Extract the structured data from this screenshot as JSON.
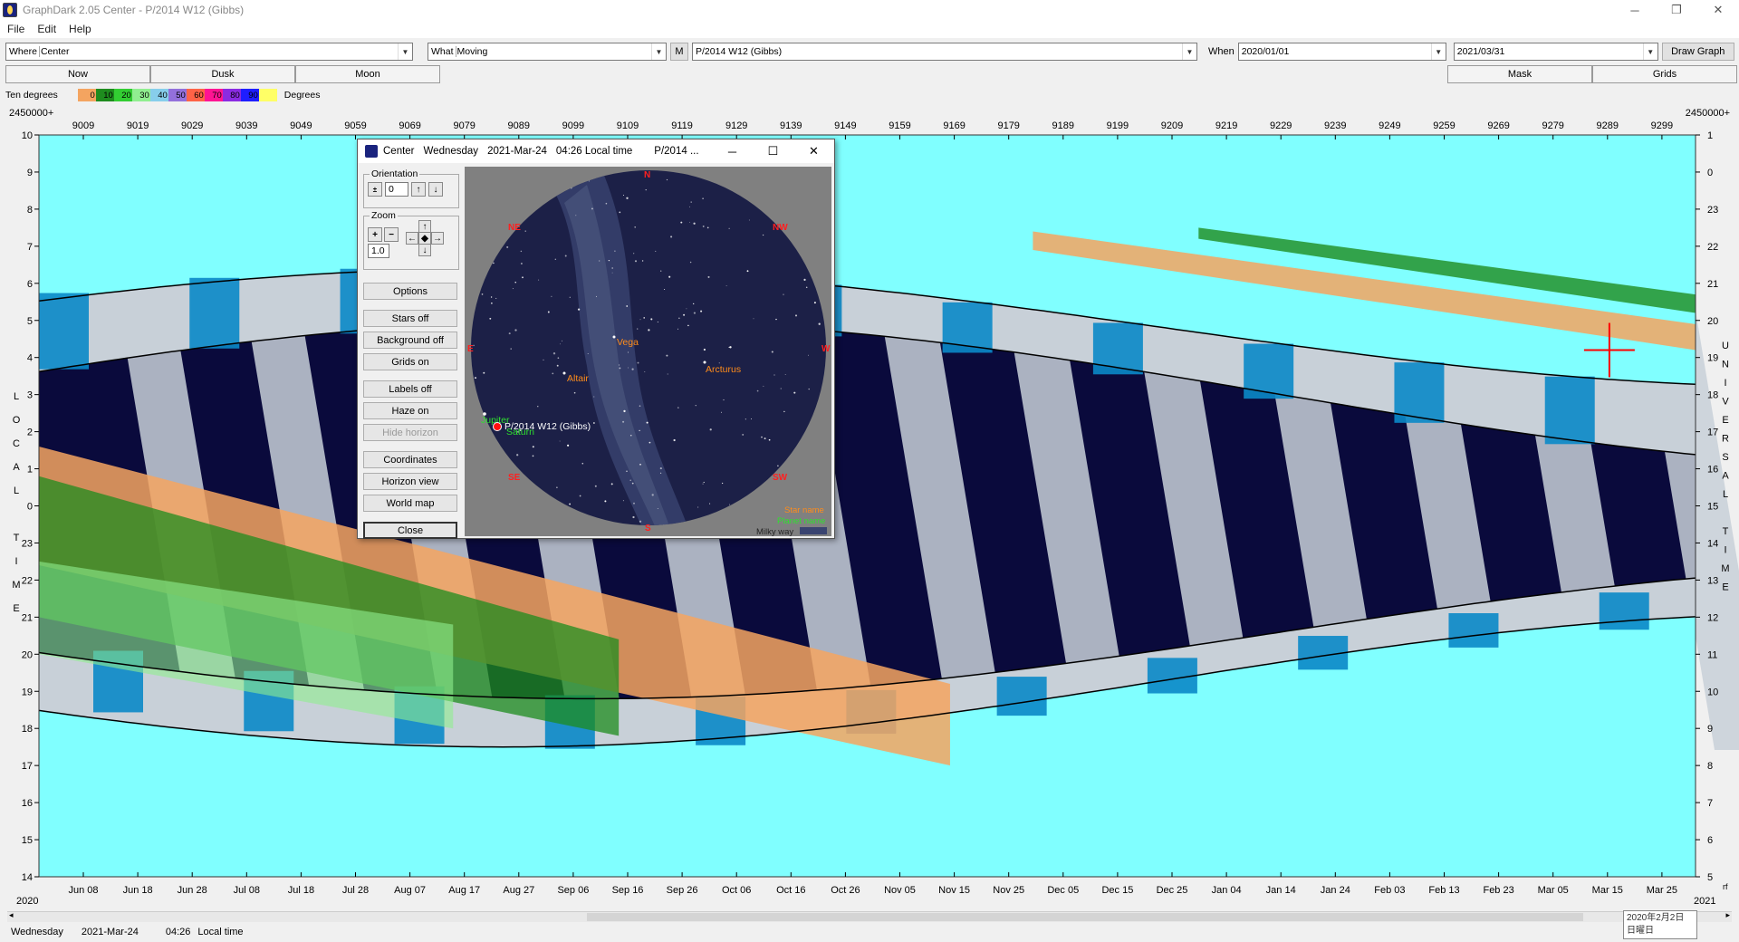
{
  "window": {
    "title": "GraphDark 2.05  Center  -  P/2014 W12 (Gibbs)",
    "minimize": "─",
    "maximize": "❐",
    "close": "✕"
  },
  "menu": [
    "File",
    "Edit",
    "Help"
  ],
  "toolbar": {
    "where_label": "Where",
    "where_value": "Center",
    "what_label": "What",
    "what_value": "Moving",
    "m_button": "M",
    "object_value": "P/2014 W12 (Gibbs)",
    "when_label": "When",
    "when_start": "2020/01/01",
    "when_end": "2021/03/31",
    "draw_graph": "Draw Graph"
  },
  "tabs_left": [
    "Now",
    "Dusk",
    "Moon"
  ],
  "tabs_right": [
    "Mask",
    "Grids"
  ],
  "legend": {
    "label": "Ten degrees",
    "segments": [
      {
        "text": "0",
        "color": "#f4a460"
      },
      {
        "text": "10",
        "color": "#1e8c1e"
      },
      {
        "text": "20",
        "color": "#32cd32"
      },
      {
        "text": "30",
        "color": "#90ee90"
      },
      {
        "text": "40",
        "color": "#87ceeb"
      },
      {
        "text": "50",
        "color": "#9370db"
      },
      {
        "text": "60",
        "color": "#ff6347"
      },
      {
        "text": "70",
        "color": "#ff1493"
      },
      {
        "text": "80",
        "color": "#8a2be2"
      },
      {
        "text": "90",
        "color": "#1e1eff"
      },
      {
        "text": "",
        "color": "#ffff66"
      }
    ],
    "unit": "Degrees"
  },
  "chart": {
    "jd_prefix_left": "2450000+",
    "jd_prefix_right": "2450000+",
    "jd_ticks": [
      "9009",
      "9019",
      "9029",
      "9039",
      "9049",
      "9059",
      "9069",
      "9079",
      "9089",
      "9099",
      "9109",
      "9119",
      "9129",
      "9139",
      "9149",
      "9159",
      "9169",
      "9179",
      "9189",
      "9199",
      "9209",
      "9219",
      "9229",
      "9239",
      "9249",
      "9259",
      "9269",
      "9279",
      "9289",
      "9299"
    ],
    "date_ticks": [
      "Jun 08",
      "Jun 18",
      "Jun 28",
      "Jul 08",
      "Jul 18",
      "Jul 28",
      "Aug 07",
      "Aug 17",
      "Aug 27",
      "Sep 06",
      "Sep 16",
      "Sep 26",
      "Oct 06",
      "Oct 16",
      "Oct 26",
      "Nov 05",
      "Nov 15",
      "Nov 25",
      "Dec 05",
      "Dec 15",
      "Dec 25",
      "Jan 04",
      "Jan 14",
      "Jan 24",
      "Feb 03",
      "Feb 13",
      "Feb 23",
      "Mar 05",
      "Mar 15",
      "Mar 25"
    ],
    "year_left": "2020",
    "year_right": "2021",
    "year_right_suffix": "rf",
    "left_axis_title": [
      "L",
      "O",
      "C",
      "A",
      "L",
      "",
      "T",
      "I",
      "M",
      "E"
    ],
    "left_ticks": [
      "10",
      "9",
      "8",
      "7",
      "6",
      "5",
      "4",
      "3",
      "2",
      "1",
      "0",
      "23",
      "22",
      "21",
      "20",
      "19",
      "18",
      "17",
      "16",
      "15",
      "14"
    ],
    "right_axis_title": [
      "U",
      "N",
      "I",
      "V",
      "E",
      "R",
      "S",
      "A",
      "L",
      "",
      "T",
      "I",
      "M",
      "E"
    ],
    "right_ticks": [
      "1",
      "0",
      "23",
      "22",
      "21",
      "20",
      "19",
      "18",
      "17",
      "16",
      "15",
      "14",
      "13",
      "12",
      "11",
      "10",
      "9",
      "8",
      "7",
      "6",
      "5"
    ],
    "colors": {
      "sky": "#80ffff",
      "night": "#0a0a3c",
      "twilight": "#c8d0d8",
      "moon": "#0a88c8",
      "object_high": "#1e8c1e",
      "object_low": "#f4a460"
    }
  },
  "popup": {
    "title_app": "Center",
    "title_day": "Wednesday",
    "title_date": "2021-Mar-24",
    "title_time": "04:26 Local time",
    "title_obj": "P/2014 ...",
    "minimize": "─",
    "maximize": "☐",
    "close": "✕",
    "orientation_label": "Orientation",
    "orientation_value": "0",
    "zoom_label": "Zoom",
    "zoom_value": "1.0",
    "buttons": [
      "Options",
      "Stars off",
      "Background off",
      "Grids on",
      "Labels off",
      "Haze on",
      "Hide horizon",
      "Coordinates",
      "Horizon view",
      "World map",
      "Close"
    ],
    "compass": {
      "n": "N",
      "ne": "NE",
      "nw": "NW",
      "e": "E",
      "w": "W",
      "se": "SE",
      "sw": "SW",
      "s": "S"
    },
    "stars": {
      "vega": "Vega",
      "altair": "Altair",
      "arcturus": "Arcturus"
    },
    "planets": {
      "jupiter": "Jupiter",
      "saturn": "Saturn"
    },
    "comet": "P/2014 W12 (Gibbs)",
    "legend": {
      "star_name": "Star name",
      "planet_name": "Planet name",
      "milky_way": "Milky way"
    }
  },
  "status": {
    "day": "Wednesday",
    "date": "2021-Mar-24",
    "time": "04:26",
    "label": "Local time"
  },
  "datebox": {
    "line1": "2020年2月2日",
    "line2": "日曜日"
  }
}
